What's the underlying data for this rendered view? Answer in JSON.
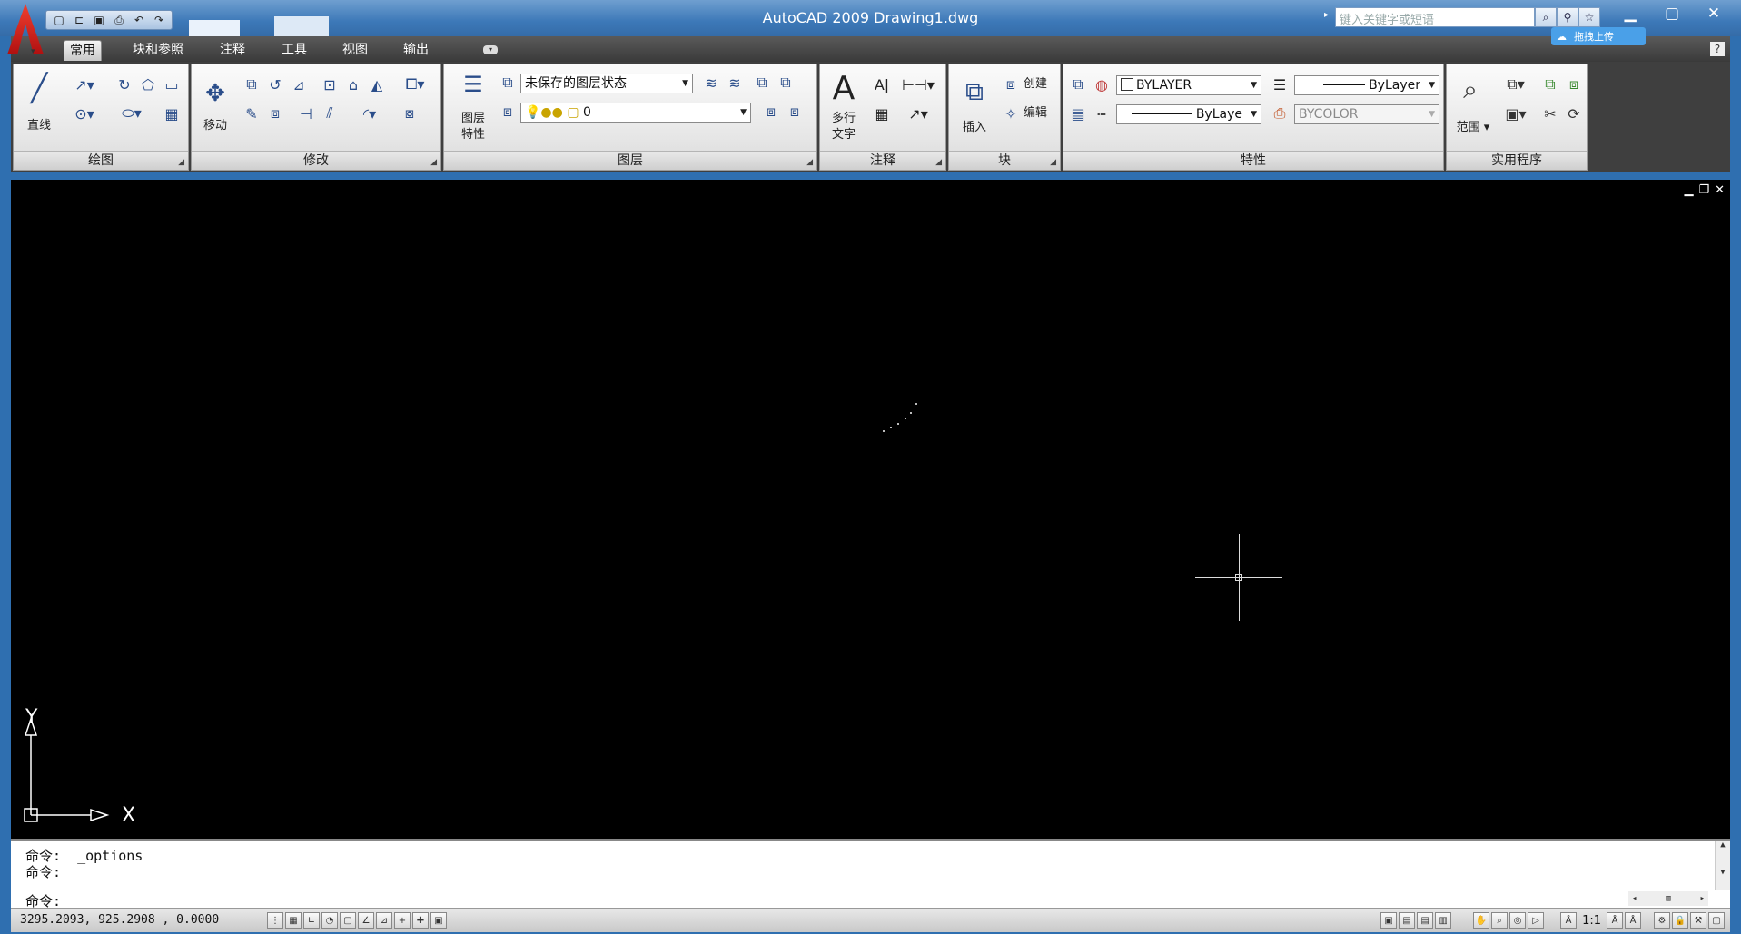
{
  "window": {
    "title": "AutoCAD 2009 Drawing1.dwg",
    "search_placeholder": "键入关键字或短语",
    "upload_label": "拖拽上传"
  },
  "tabs": [
    {
      "label": "常用",
      "active": true
    },
    {
      "label": "块和参照"
    },
    {
      "label": "注释"
    },
    {
      "label": "工具"
    },
    {
      "label": "视图"
    },
    {
      "label": "输出"
    }
  ],
  "panels": {
    "draw": {
      "title": "绘图",
      "line_label": "直线"
    },
    "modify": {
      "title": "修改",
      "move_label": "移动"
    },
    "layer": {
      "title": "图层",
      "props_label_1": "图层",
      "props_label_2": "特性",
      "state_value": "未保存的图层状态",
      "layer_value": "0"
    },
    "annotation": {
      "title": "注释",
      "mtext_label_1": "多行",
      "mtext_label_2": "文字"
    },
    "block": {
      "title": "块",
      "insert_label": "插入",
      "create_label": "创建",
      "edit_label": "编辑"
    },
    "properties": {
      "title": "特性",
      "color_value": "BYLAYER",
      "lineweight_value": "ByLayer",
      "linetype_value": "ByLaye",
      "plotstyle_value": "BYCOLOR"
    },
    "utilities": {
      "title": "实用程序",
      "extents_label": "范围"
    }
  },
  "ucs": {
    "x_label": "X",
    "y_label": "Y"
  },
  "command": {
    "line1": "命令:  _options",
    "line2": "命令:",
    "prompt": "命令:"
  },
  "status": {
    "coordinates": "3295.2093,  925.2908 ,  0.0000",
    "annotation_scale": "1:1"
  }
}
